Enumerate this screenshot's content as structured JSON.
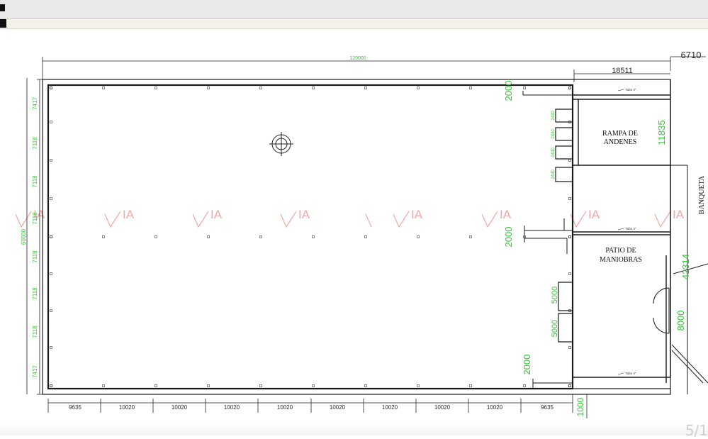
{
  "viewer": {
    "page_indicator": "5/1"
  },
  "plan": {
    "overall_length": "120000",
    "right_strip_width": "6710",
    "overall_depth": "60000",
    "right_top_width": "18511",
    "left_dims": [
      "7417",
      "7118",
      "7118",
      "7118",
      "7118",
      "7118",
      "7118",
      "7417"
    ],
    "bottom_dims": [
      "9635",
      "10020",
      "10020",
      "10020",
      "10020",
      "10020",
      "10020",
      "10020",
      "10020",
      "9635"
    ],
    "green_dims": {
      "top_gap": "2000",
      "mid_gap": "2000",
      "bottom_gap": "2000",
      "ramp_height": "11835",
      "patio_height": "42314",
      "door_a": "5000",
      "door_b": "5000",
      "gate": "8000",
      "bottom_offset": "1000"
    },
    "dock_dims": [
      "2440",
      "2440",
      "2440",
      "2440"
    ],
    "rooms": {
      "ramp_line1": "RAMPA DE",
      "ramp_line2": "ANDENES",
      "patio_line1": "PATIO DE",
      "patio_line2": "MANIOBRAS",
      "sidewalk": "BANQUETA"
    },
    "drain_label": "Tubo 4\"",
    "watermark": "IA"
  }
}
